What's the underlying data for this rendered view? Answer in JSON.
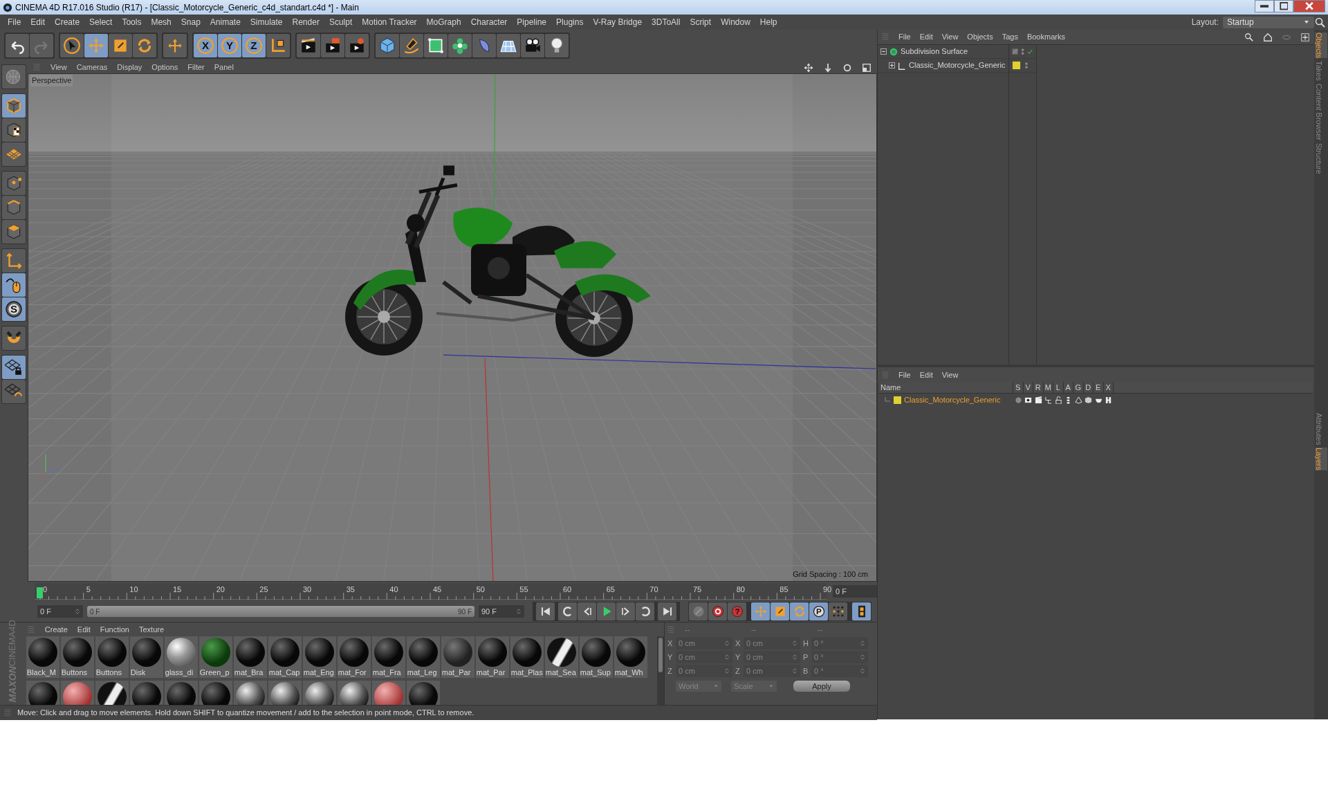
{
  "window": {
    "title": "CINEMA 4D R17.016 Studio (R17) - [Classic_Motorcycle_Generic_c4d_standart.c4d *] - Main"
  },
  "menu_bar": [
    "File",
    "Edit",
    "Create",
    "Select",
    "Tools",
    "Mesh",
    "Snap",
    "Animate",
    "Simulate",
    "Render",
    "Sculpt",
    "Motion Tracker",
    "MoGraph",
    "Character",
    "Pipeline",
    "Plugins",
    "V-Ray Bridge",
    "3DToAll",
    "Script",
    "Window",
    "Help"
  ],
  "layout": {
    "label": "Layout:",
    "value": "Startup"
  },
  "toolbar": [
    [
      {
        "kind": "undo",
        "active": false
      },
      {
        "kind": "redo",
        "active": false
      }
    ],
    [
      {
        "kind": "select",
        "active": false
      },
      {
        "kind": "move",
        "active": true
      },
      {
        "kind": "scale",
        "active": false
      },
      {
        "kind": "rotate",
        "active": false
      }
    ],
    [
      {
        "kind": "move-plus",
        "active": false
      }
    ],
    [
      {
        "kind": "axis",
        "label": "X",
        "active": true
      },
      {
        "kind": "axis",
        "label": "Y",
        "active": true
      },
      {
        "kind": "axis",
        "label": "Z",
        "active": true
      },
      {
        "kind": "coord",
        "active": false
      }
    ],
    [
      {
        "kind": "render-view",
        "active": false
      },
      {
        "kind": "render",
        "active": false
      },
      {
        "kind": "render-settings",
        "active": false
      }
    ],
    [
      {
        "kind": "cube",
        "active": false
      },
      {
        "kind": "pen",
        "active": false
      },
      {
        "kind": "subdiv",
        "active": false
      },
      {
        "kind": "cloner",
        "active": false
      },
      {
        "kind": "deformer",
        "active": false
      },
      {
        "kind": "floor",
        "active": false
      },
      {
        "kind": "camera",
        "active": false
      },
      {
        "kind": "light",
        "active": false
      }
    ]
  ],
  "left_toolbar": [
    [
      {
        "kind": "make-editable",
        "active": false
      }
    ],
    [
      {
        "kind": "model",
        "active": true
      },
      {
        "kind": "texture",
        "active": false
      },
      {
        "kind": "workplane",
        "active": false
      }
    ],
    [
      {
        "kind": "points",
        "active": false
      },
      {
        "kind": "edges",
        "active": false
      },
      {
        "kind": "polygons",
        "active": false
      }
    ],
    [
      {
        "kind": "axis-mode",
        "active": false
      },
      {
        "kind": "tweak",
        "active": true
      },
      {
        "kind": "solo",
        "label": "S",
        "active": true
      }
    ],
    [
      {
        "kind": "magnet",
        "active": false
      }
    ],
    [
      {
        "kind": "grid-lock",
        "active": true
      },
      {
        "kind": "grid-sync",
        "active": false
      }
    ]
  ],
  "viewport": {
    "menu": [
      "View",
      "Cameras",
      "Display",
      "Options",
      "Filter",
      "Panel"
    ],
    "camera": "Perspective",
    "grid_spacing": "Grid Spacing : 100 cm"
  },
  "timeline": {
    "ticks": [
      "0",
      "5",
      "10",
      "15",
      "20",
      "25",
      "30",
      "35",
      "40",
      "45",
      "50",
      "55",
      "60",
      "65",
      "70",
      "75",
      "80",
      "85",
      "90"
    ],
    "current_frame": "0 F",
    "start_field": "0 F",
    "range": {
      "start": "0 F",
      "end": "90 F",
      "level": 1
    },
    "end_field": "90 F"
  },
  "playback": [
    {
      "kind": "first"
    },
    {
      "kind": "prev-key"
    },
    {
      "kind": "prev-frame"
    },
    {
      "kind": "play"
    },
    {
      "kind": "next-frame"
    },
    {
      "kind": "next-key"
    },
    {
      "kind": "last"
    }
  ],
  "key_tools": [
    {
      "kind": "record-off",
      "active": false
    },
    {
      "kind": "record",
      "active": false
    },
    {
      "kind": "help",
      "label": "?",
      "active": false
    },
    {
      "kind": "move",
      "active": true
    },
    {
      "kind": "scale",
      "active": true
    },
    {
      "kind": "rotate",
      "active": true
    },
    {
      "kind": "param",
      "label": "P",
      "active": true
    },
    {
      "kind": "dots",
      "active": false
    },
    {
      "kind": "film",
      "active": true
    }
  ],
  "material_manager": {
    "menu": [
      "Create",
      "Edit",
      "Function",
      "Texture"
    ],
    "materials": [
      {
        "name": "Black_M",
        "kind": "black"
      },
      {
        "name": "Buttons",
        "kind": "black"
      },
      {
        "name": "Buttons",
        "kind": "black"
      },
      {
        "name": "Disk",
        "kind": "black"
      },
      {
        "name": "glass_di",
        "kind": "glass"
      },
      {
        "name": "Green_p",
        "kind": "green"
      },
      {
        "name": "mat_Bra",
        "kind": "black"
      },
      {
        "name": "mat_Cap",
        "kind": "black"
      },
      {
        "name": "mat_Eng",
        "kind": "black"
      },
      {
        "name": "mat_For",
        "kind": "black"
      },
      {
        "name": "mat_Fra",
        "kind": "black"
      },
      {
        "name": "mat_Leg",
        "kind": "black"
      },
      {
        "name": "mat_Par",
        "kind": "dark"
      },
      {
        "name": "mat_Par",
        "kind": "black"
      },
      {
        "name": "mat_Plas",
        "kind": "black"
      },
      {
        "name": "mat_Sea",
        "kind": "twotone"
      },
      {
        "name": "mat_Sup",
        "kind": "black"
      },
      {
        "name": "mat_Wh",
        "kind": "black"
      }
    ],
    "materials_row_2": [
      {
        "kind": "black"
      },
      {
        "kind": "red"
      },
      {
        "kind": "twotone"
      },
      {
        "kind": "black"
      },
      {
        "kind": "black"
      },
      {
        "kind": "black"
      },
      {
        "kind": "chrome"
      },
      {
        "kind": "chrome"
      },
      {
        "kind": "chrome"
      },
      {
        "kind": "chrome"
      },
      {
        "kind": "red"
      },
      {
        "kind": "black"
      }
    ]
  },
  "brand": [
    "MAXON",
    "CINEMA4D"
  ],
  "coordinates": {
    "headers": [
      "--",
      "--",
      "--"
    ],
    "rows": [
      {
        "pos_axis": "X",
        "position": "0 cm",
        "size_axis": "X",
        "size": "0 cm",
        "rot_axis": "H",
        "rotation": "0 °"
      },
      {
        "pos_axis": "Y",
        "position": "0 cm",
        "size_axis": "Y",
        "size": "0 cm",
        "rot_axis": "P",
        "rotation": "0 °"
      },
      {
        "pos_axis": "Z",
        "position": "0 cm",
        "size_axis": "Z",
        "size": "0 cm",
        "rot_axis": "B",
        "rotation": "0 °"
      }
    ],
    "mode": "World",
    "scale_mode": "Scale",
    "apply": "Apply"
  },
  "status_bar": "Move: Click and drag to move elements. Hold down SHIFT to quantize movement / add to the selection in point mode, CTRL to remove.",
  "object_manager": {
    "menu": [
      "File",
      "Edit",
      "View",
      "Objects",
      "Tags",
      "Bookmarks"
    ],
    "tree": [
      {
        "name": "Subdivision Surface",
        "kind": "subdiv",
        "expanded": true,
        "children": [
          {
            "name": "Classic_Motorcycle_Generic",
            "kind": "null",
            "expanded": false
          }
        ]
      }
    ]
  },
  "layer_manager": {
    "menu": [
      "File",
      "Edit",
      "View"
    ],
    "columns": [
      "Name",
      "S",
      "V",
      "R",
      "M",
      "L",
      "A",
      "G",
      "D",
      "E",
      "X"
    ],
    "layers": [
      {
        "name": "Classic_Motorcycle_Generic",
        "color": "#e0d030"
      }
    ]
  },
  "side_tabs_top": [
    {
      "label": "Objects",
      "selected": true
    },
    {
      "label": "Takes",
      "selected": false
    },
    {
      "label": "Content Browser",
      "selected": false
    },
    {
      "label": "Structure",
      "selected": false
    }
  ],
  "side_tabs_bottom": [
    {
      "label": "Attributes",
      "selected": false
    },
    {
      "label": "Layers",
      "selected": true
    }
  ]
}
